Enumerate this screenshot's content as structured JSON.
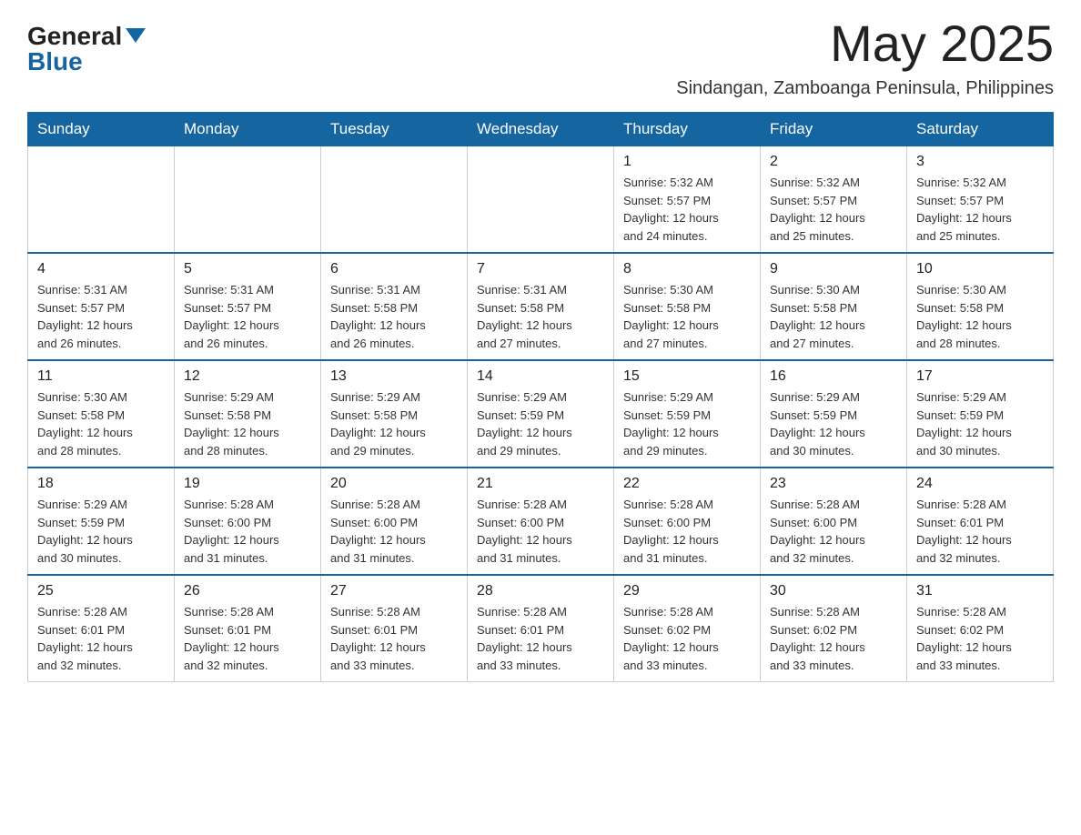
{
  "logo": {
    "general": "General",
    "blue": "Blue"
  },
  "header": {
    "month_year": "May 2025",
    "subtitle": "Sindangan, Zamboanga Peninsula, Philippines"
  },
  "weekdays": [
    "Sunday",
    "Monday",
    "Tuesday",
    "Wednesday",
    "Thursday",
    "Friday",
    "Saturday"
  ],
  "weeks": [
    [
      {
        "day": "",
        "info": ""
      },
      {
        "day": "",
        "info": ""
      },
      {
        "day": "",
        "info": ""
      },
      {
        "day": "",
        "info": ""
      },
      {
        "day": "1",
        "info": "Sunrise: 5:32 AM\nSunset: 5:57 PM\nDaylight: 12 hours\nand 24 minutes."
      },
      {
        "day": "2",
        "info": "Sunrise: 5:32 AM\nSunset: 5:57 PM\nDaylight: 12 hours\nand 25 minutes."
      },
      {
        "day": "3",
        "info": "Sunrise: 5:32 AM\nSunset: 5:57 PM\nDaylight: 12 hours\nand 25 minutes."
      }
    ],
    [
      {
        "day": "4",
        "info": "Sunrise: 5:31 AM\nSunset: 5:57 PM\nDaylight: 12 hours\nand 26 minutes."
      },
      {
        "day": "5",
        "info": "Sunrise: 5:31 AM\nSunset: 5:57 PM\nDaylight: 12 hours\nand 26 minutes."
      },
      {
        "day": "6",
        "info": "Sunrise: 5:31 AM\nSunset: 5:58 PM\nDaylight: 12 hours\nand 26 minutes."
      },
      {
        "day": "7",
        "info": "Sunrise: 5:31 AM\nSunset: 5:58 PM\nDaylight: 12 hours\nand 27 minutes."
      },
      {
        "day": "8",
        "info": "Sunrise: 5:30 AM\nSunset: 5:58 PM\nDaylight: 12 hours\nand 27 minutes."
      },
      {
        "day": "9",
        "info": "Sunrise: 5:30 AM\nSunset: 5:58 PM\nDaylight: 12 hours\nand 27 minutes."
      },
      {
        "day": "10",
        "info": "Sunrise: 5:30 AM\nSunset: 5:58 PM\nDaylight: 12 hours\nand 28 minutes."
      }
    ],
    [
      {
        "day": "11",
        "info": "Sunrise: 5:30 AM\nSunset: 5:58 PM\nDaylight: 12 hours\nand 28 minutes."
      },
      {
        "day": "12",
        "info": "Sunrise: 5:29 AM\nSunset: 5:58 PM\nDaylight: 12 hours\nand 28 minutes."
      },
      {
        "day": "13",
        "info": "Sunrise: 5:29 AM\nSunset: 5:58 PM\nDaylight: 12 hours\nand 29 minutes."
      },
      {
        "day": "14",
        "info": "Sunrise: 5:29 AM\nSunset: 5:59 PM\nDaylight: 12 hours\nand 29 minutes."
      },
      {
        "day": "15",
        "info": "Sunrise: 5:29 AM\nSunset: 5:59 PM\nDaylight: 12 hours\nand 29 minutes."
      },
      {
        "day": "16",
        "info": "Sunrise: 5:29 AM\nSunset: 5:59 PM\nDaylight: 12 hours\nand 30 minutes."
      },
      {
        "day": "17",
        "info": "Sunrise: 5:29 AM\nSunset: 5:59 PM\nDaylight: 12 hours\nand 30 minutes."
      }
    ],
    [
      {
        "day": "18",
        "info": "Sunrise: 5:29 AM\nSunset: 5:59 PM\nDaylight: 12 hours\nand 30 minutes."
      },
      {
        "day": "19",
        "info": "Sunrise: 5:28 AM\nSunset: 6:00 PM\nDaylight: 12 hours\nand 31 minutes."
      },
      {
        "day": "20",
        "info": "Sunrise: 5:28 AM\nSunset: 6:00 PM\nDaylight: 12 hours\nand 31 minutes."
      },
      {
        "day": "21",
        "info": "Sunrise: 5:28 AM\nSunset: 6:00 PM\nDaylight: 12 hours\nand 31 minutes."
      },
      {
        "day": "22",
        "info": "Sunrise: 5:28 AM\nSunset: 6:00 PM\nDaylight: 12 hours\nand 31 minutes."
      },
      {
        "day": "23",
        "info": "Sunrise: 5:28 AM\nSunset: 6:00 PM\nDaylight: 12 hours\nand 32 minutes."
      },
      {
        "day": "24",
        "info": "Sunrise: 5:28 AM\nSunset: 6:01 PM\nDaylight: 12 hours\nand 32 minutes."
      }
    ],
    [
      {
        "day": "25",
        "info": "Sunrise: 5:28 AM\nSunset: 6:01 PM\nDaylight: 12 hours\nand 32 minutes."
      },
      {
        "day": "26",
        "info": "Sunrise: 5:28 AM\nSunset: 6:01 PM\nDaylight: 12 hours\nand 32 minutes."
      },
      {
        "day": "27",
        "info": "Sunrise: 5:28 AM\nSunset: 6:01 PM\nDaylight: 12 hours\nand 33 minutes."
      },
      {
        "day": "28",
        "info": "Sunrise: 5:28 AM\nSunset: 6:01 PM\nDaylight: 12 hours\nand 33 minutes."
      },
      {
        "day": "29",
        "info": "Sunrise: 5:28 AM\nSunset: 6:02 PM\nDaylight: 12 hours\nand 33 minutes."
      },
      {
        "day": "30",
        "info": "Sunrise: 5:28 AM\nSunset: 6:02 PM\nDaylight: 12 hours\nand 33 minutes."
      },
      {
        "day": "31",
        "info": "Sunrise: 5:28 AM\nSunset: 6:02 PM\nDaylight: 12 hours\nand 33 minutes."
      }
    ]
  ]
}
